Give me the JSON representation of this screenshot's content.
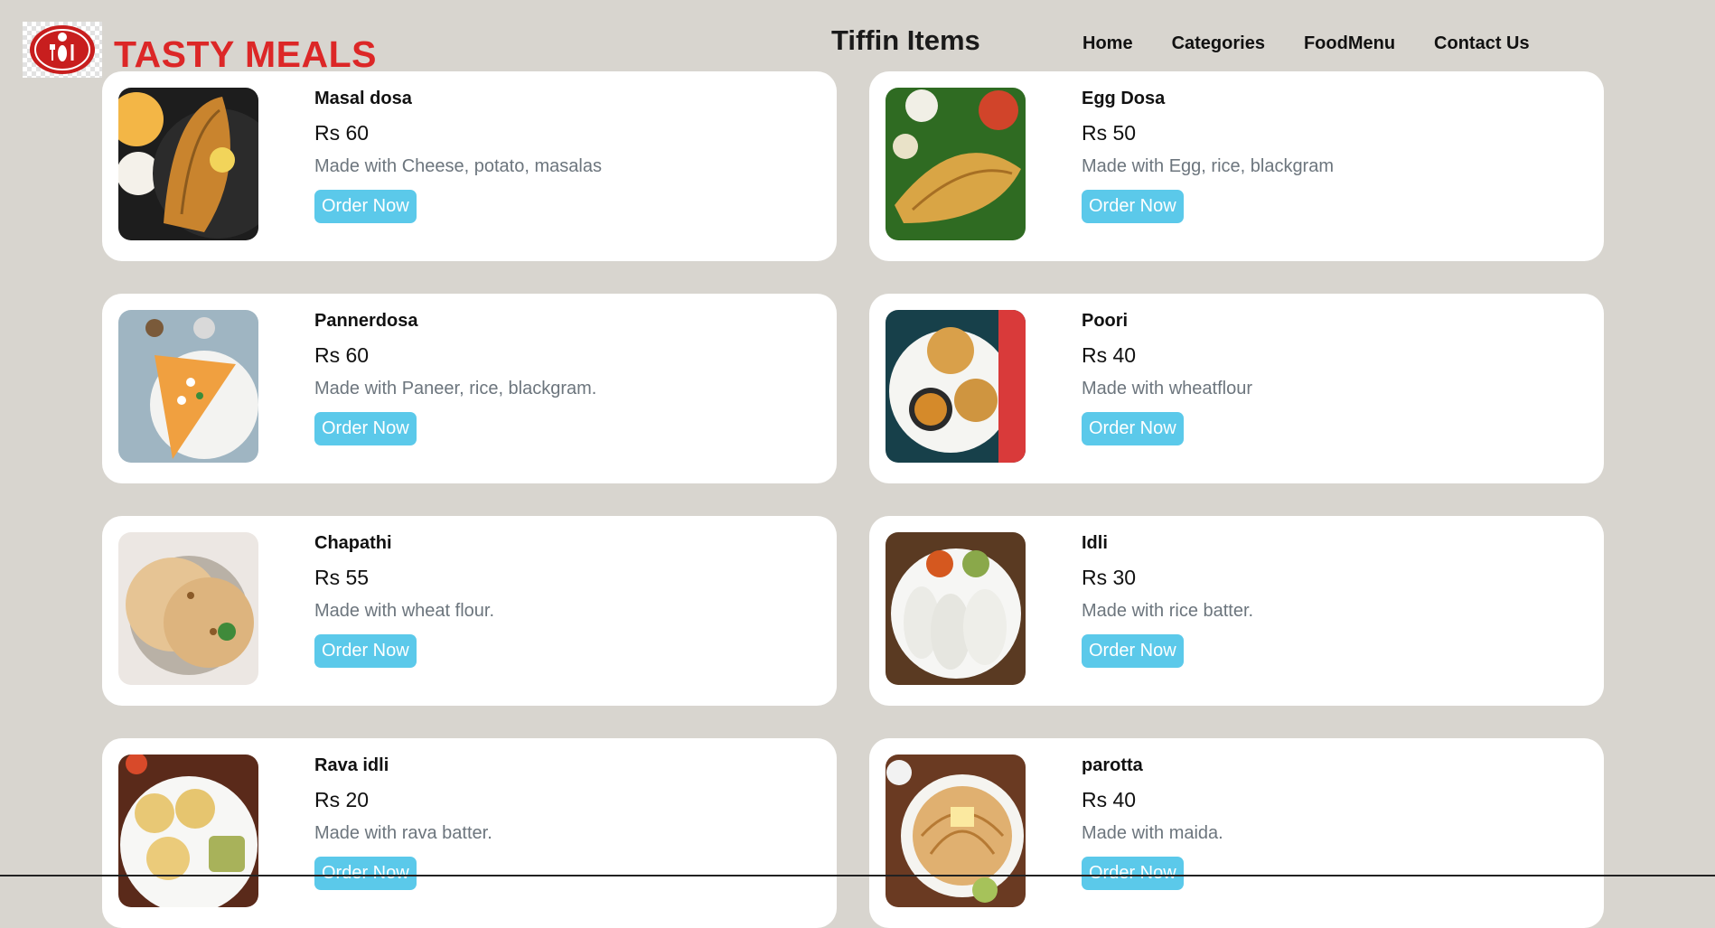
{
  "header": {
    "brand": "TASTY MEALS",
    "page_title": "Tiffin Items",
    "nav": [
      "Home",
      "Categories",
      "FoodMenu",
      "Contact Us"
    ]
  },
  "items": [
    {
      "name": "Masal dosa",
      "price": "Rs 60",
      "desc": "Made with Cheese, potato, masalas",
      "button": "Order Now",
      "image": "masala-dosa-image"
    },
    {
      "name": "Egg Dosa",
      "price": "Rs 50",
      "desc": "Made with Egg, rice, blackgram",
      "button": "Order Now",
      "image": "egg-dosa-image"
    },
    {
      "name": "Pannerdosa",
      "price": "Rs 60",
      "desc": "Made with Paneer, rice, blackgram.",
      "button": "Order Now",
      "image": "paneer-dosa-image"
    },
    {
      "name": "Poori",
      "price": "Rs 40",
      "desc": "Made with wheatflour",
      "button": "Order Now",
      "image": "poori-image"
    },
    {
      "name": "Chapathi",
      "price": "Rs 55",
      "desc": "Made with wheat flour.",
      "button": "Order Now",
      "image": "chapathi-image"
    },
    {
      "name": "Idli",
      "price": "Rs 30",
      "desc": "Made with rice batter.",
      "button": "Order Now",
      "image": "idli-image"
    },
    {
      "name": "Rava idli",
      "price": "Rs 20",
      "desc": "Made with rava batter.",
      "button": "Order Now",
      "image": "rava-idli-image"
    },
    {
      "name": "parotta",
      "price": "Rs 40",
      "desc": "Made with maida.",
      "button": "Order Now",
      "image": "parotta-image"
    }
  ],
  "colors": {
    "brand": "#dc2727",
    "button": "#5bc9ea",
    "background": "#d8d5cf",
    "desc": "#6c757d"
  }
}
